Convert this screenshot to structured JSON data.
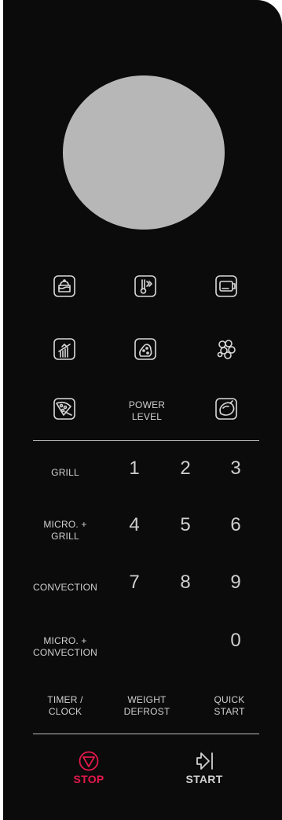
{
  "panel": {
    "accent_stop": "#e2184b",
    "background": "#0b0b0b",
    "dial_color": "#b7b7b8"
  },
  "icons": [
    {
      "name": "cake-icon"
    },
    {
      "name": "thermometer-icon"
    },
    {
      "name": "oven-icon"
    },
    {
      "name": "grill-rack-icon"
    },
    {
      "name": "potato-icon"
    },
    {
      "name": "vegetables-icon"
    },
    {
      "name": "pizza-icon"
    },
    {
      "name": "chicken-icon"
    }
  ],
  "buttons": {
    "power_level": "POWER\nLEVEL",
    "grill": "GRILL",
    "micro_grill": "MICRO. +\nGRILL",
    "convection": "CONVECTION",
    "micro_convection": "MICRO. +\nCONVECTION",
    "timer_clock": "TIMER /\nCLOCK",
    "weight_defrost": "WEIGHT\nDEFROST",
    "quick_start": "QUICK\nSTART",
    "stop": "STOP",
    "start": "START"
  },
  "keypad": {
    "k1": "1",
    "k2": "2",
    "k3": "3",
    "k4": "4",
    "k5": "5",
    "k6": "6",
    "k7": "7",
    "k8": "8",
    "k9": "9",
    "k0": "0"
  }
}
